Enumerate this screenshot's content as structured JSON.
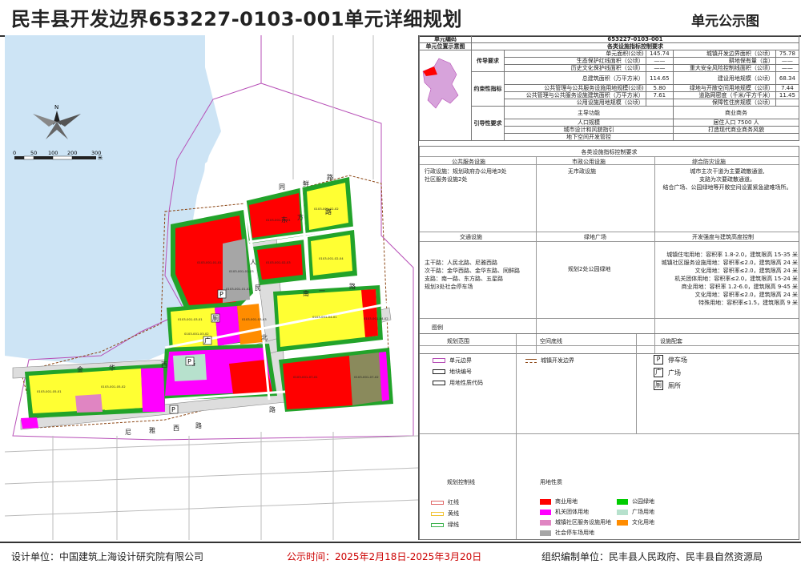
{
  "header": {
    "title": "民丰县开发边界653227-0103-001单元详细规划",
    "subtitle": "单元公示图"
  },
  "footer": {
    "design": "设计单位：中国建筑上海设计研究院有限公司",
    "period": "公示时间：2025年2月18日-2025年3月20日",
    "organizer": "组织编制单位：民丰县人民政府、民丰县自然资源局"
  },
  "info": {
    "unit_code_label": "单元编码",
    "unit_code": "653227-0103-001",
    "location_label": "单元位置示意图",
    "control_header": "各类设施指标控制要求",
    "groups": [
      {
        "name": "传导要求",
        "rows": [
          [
            "单元面积(公顷)",
            "145.74",
            "城镇开发边界面积（公顷）",
            "75.78"
          ],
          [
            "生态保护红线面积（公顷）",
            "——",
            "耕地保有量（亩）",
            "——"
          ],
          [
            "历史文化保护线面积（公顷）",
            "——",
            "重大安全风险控制线面积（公顷）",
            "——"
          ]
        ]
      },
      {
        "name": "约束性指标",
        "rows": [
          [
            "总建筑面积（万平方米）",
            "114.65",
            "建设用地规模（公顷）",
            "68.34"
          ],
          [
            "公共管理与公共服务设施用地规模(公顷)",
            "5.80",
            "绿地与开敞空间用地规模（公顷）",
            "7.44"
          ],
          [
            "公共管理与公共服务设施建筑面积（万平方米）",
            "7.61",
            "道路网密度（千米/平方千米）",
            "11.45"
          ],
          [
            "公用设施用地规模（公顷）",
            "",
            "保障性住房规模（公顷）",
            ""
          ]
        ]
      },
      {
        "name": "引导性要求",
        "rows": [
          [
            "主导功能",
            "商业商务"
          ],
          [
            "人口规模",
            "居住人口 7500 人"
          ],
          [
            "城市设计和风貌指引",
            "打造现代商业商务风貌"
          ],
          [
            "地下空间开发管控",
            ""
          ]
        ]
      }
    ]
  },
  "facilities": {
    "header": "各类设施指标控制要求",
    "cols": [
      "公共服务设施",
      "市政公用设施",
      "综合防灾设施"
    ],
    "public": "行政设施：规划政府办公用地3处\n社区服务设施2处",
    "municipal": "无市政设施",
    "disaster": "城市主次干道为主要疏散通道,\n支路为次要疏散通道。\n结合广场、公园绿地等开敞空间设置紧急避难场所。",
    "cols2": [
      "交通设施",
      "绿地广场",
      "开发强度与建筑高度控制"
    ],
    "traffic": "主干路：人民北路、尼雅西路\n次干路：金华西路、金华东路、同鲜路\n支路：南一路、东方路、五星路\n规划3处社会停车场",
    "green": "规划2处公园绿地",
    "intensity": "城镇住宅用地：容积率 1.8-2.0，建筑限高 15-35 米\n城镇社区服务设施用地：容积率≤2.0，建筑限高 24 米\n文化用地：容积率≤2.0，建筑限高 24 米\n机关团体用地：容积率≤2.0，建筑限高 15-24 米\n商业用地：容积率 1.2-6.0，建筑限高 9-45 米\n文化用地：容积率≤2.0，建筑限高 24 米\n特殊用地：容积率≤1.5，建筑限高 9 米"
  },
  "legend": {
    "title": "图例",
    "cols": [
      "规划范围",
      "空间底线",
      "设施配套"
    ],
    "scope": [
      "单元边界",
      "地块编号",
      "用地性质代码"
    ],
    "baseline": [
      "城镇开发边界"
    ],
    "facility_items": [
      {
        "glyph": "P",
        "label": "停车场"
      },
      {
        "glyph": "广",
        "label": "广场"
      },
      {
        "glyph": "厕",
        "label": "厕所"
      }
    ],
    "control_title": "规划控制线",
    "landuse_title": "用地性质",
    "control_lines": [
      {
        "label": "红线",
        "color": "#e06666"
      },
      {
        "label": "黄线",
        "color": "#f1c232"
      },
      {
        "label": "绿线",
        "color": "#38b04a"
      }
    ],
    "landuse_left": [
      {
        "label": "商业用地",
        "color": "#ff0000"
      },
      {
        "label": "机关团体用地",
        "color": "#ff00ff"
      },
      {
        "label": "城镇社区服务设施用地",
        "color": "#e085c2"
      },
      {
        "label": "社会停车场用地",
        "color": "#a6a6a6"
      }
    ],
    "landuse_right": [
      {
        "label": "公园绿地",
        "color": "#00cc00"
      },
      {
        "label": "广场用地",
        "color": "#b7e1cd"
      },
      {
        "label": "文化用地",
        "color": "#ff8c00"
      }
    ]
  },
  "map": {
    "scale_labels": [
      "0",
      "50",
      "100",
      "200",
      "300"
    ],
    "scale_unit": "米",
    "compass": "N",
    "roads": [
      "人",
      "民",
      "北",
      "路",
      "尼",
      "雅",
      "西",
      "路",
      "金",
      "华",
      "西",
      "路",
      "东",
      "方",
      "路",
      "南",
      "一",
      "路",
      "同",
      "鲜",
      "路"
    ],
    "plots": [
      "0103-001-02-01",
      "0103-001-02-02",
      "0103-001-02-03",
      "0103-001-02-04",
      "0103-001-01-01",
      "0103-001-01-02",
      "0103-001-01-03",
      "0103-001-03-01",
      "0103-001-03-02",
      "0103-001-03-03",
      "0103-001-04-01",
      "0103-001-04-02",
      "0103-001-05-01",
      "0103-001-05-02",
      "0103-001-07-01",
      "0103-001-07-02"
    ]
  }
}
